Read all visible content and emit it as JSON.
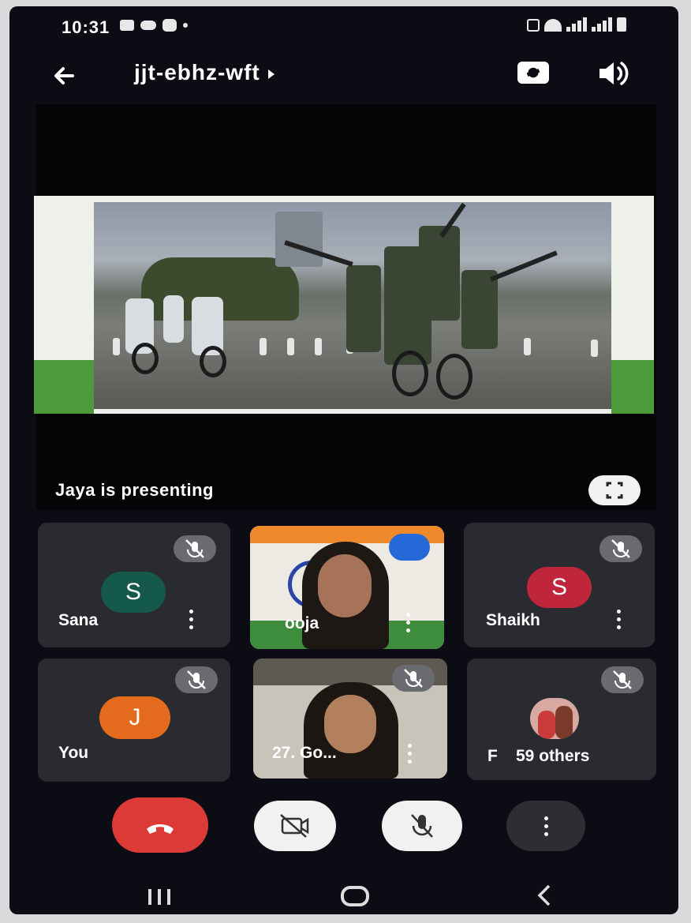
{
  "status_bar": {
    "time": "10:31"
  },
  "meeting": {
    "code": "jjt-ebhz-wft"
  },
  "presentation": {
    "banner": "Jaya is presenting"
  },
  "participants": [
    {
      "name": "Sana",
      "initial": "S",
      "avatar_color": "#14594a"
    },
    {
      "name": "Pooja",
      "display": "ooja"
    },
    {
      "name": "Shaikh",
      "initial": "S",
      "avatar_color": "#c0263b"
    },
    {
      "name": "You",
      "initial": "J",
      "avatar_color": "#e46a1e"
    },
    {
      "name": "27. Go..."
    },
    {
      "name": "F",
      "others": "59 others"
    }
  ],
  "colors": {
    "end_call": "#db3a36",
    "light_button": "#f1f1f1",
    "more_button": "#2d2e34",
    "tile": "#2a2b31"
  },
  "icons": [
    "back-arrow-icon",
    "caret-right-icon",
    "switch-camera-icon",
    "speaker-icon",
    "fullscreen-icon",
    "mic-off-icon",
    "more-vert-icon",
    "end-call-icon",
    "camera-off-icon",
    "recents-icon",
    "home-icon",
    "back-nav-icon"
  ]
}
